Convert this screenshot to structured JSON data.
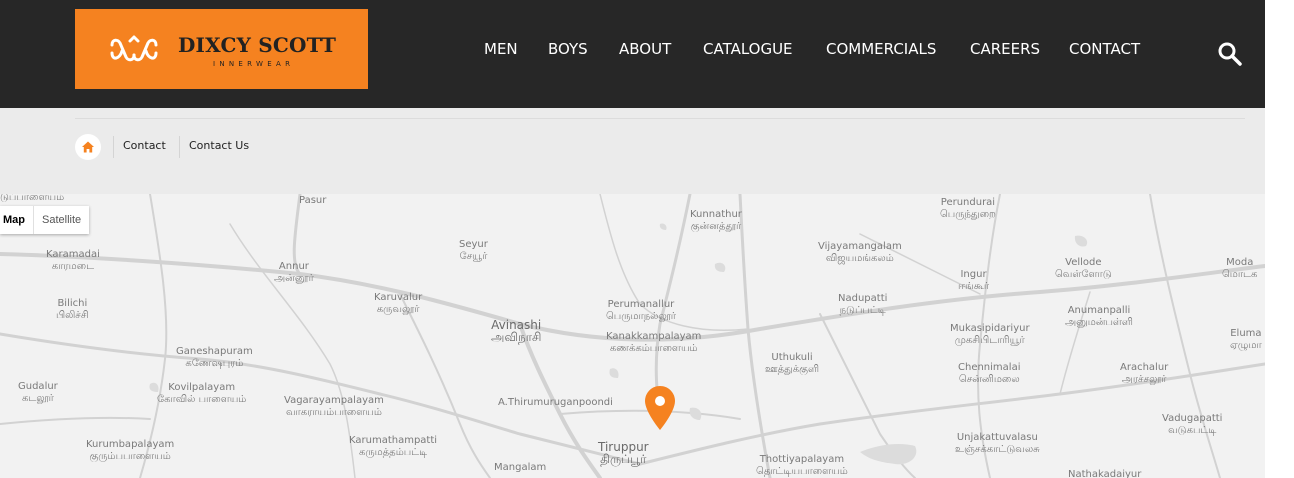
{
  "brand": {
    "title": "DIXCY SCOTT",
    "subtitle": "INNERWEAR",
    "color": "#f58220"
  },
  "nav": {
    "items": [
      "MEN",
      "BOYS",
      "ABOUT",
      "CATALOGUE",
      "COMMERCIALS",
      "CAREERS",
      "CONTACT"
    ],
    "search_icon": "search-icon"
  },
  "breadcrumb": {
    "home_icon": "home-icon",
    "items": [
      "Contact",
      "Contact Us"
    ]
  },
  "map": {
    "toggle": {
      "map": "Map",
      "satellite": "Satellite",
      "selected": "Map"
    },
    "places": [
      {
        "en": "டுப்பாளையம்",
        "ta": ""
      },
      {
        "en": "Pasur",
        "ta": ""
      },
      {
        "en": "Karamadai",
        "ta": "காரமடை"
      },
      {
        "en": "Annur",
        "ta": "அன்னூர்"
      },
      {
        "en": "Seyur",
        "ta": "சேயூர்"
      },
      {
        "en": "Kunnathur",
        "ta": "குன்னத்தூர்"
      },
      {
        "en": "Vijayamangalam",
        "ta": "விஜயமங்கலம்"
      },
      {
        "en": "Perundurai",
        "ta": "பெருந்துறை"
      },
      {
        "en": "Vellode",
        "ta": "வெள்ளோடு"
      },
      {
        "en": "Moda",
        "ta": "மொடக"
      },
      {
        "en": "Ingur",
        "ta": "ஈங்கூர்"
      },
      {
        "en": "Bilichi",
        "ta": "பிலிச்சி"
      },
      {
        "en": "Karuvalur",
        "ta": "கருவலூர்"
      },
      {
        "en": "Perumanallur",
        "ta": "பெருமாநல்லூர்"
      },
      {
        "en": "Nadupatti",
        "ta": "நடுப்பட்டி"
      },
      {
        "en": "Avinashi",
        "ta": "அவிநாசி"
      },
      {
        "en": "Kanakkampalayam",
        "ta": "கணக்கம்பாளையம்"
      },
      {
        "en": "Mukasipidariyur",
        "ta": "முகசிபிடாரியூர்"
      },
      {
        "en": "Anumanpalli",
        "ta": "அனுமன்பள்ளி"
      },
      {
        "en": "Eluma",
        "ta": "ஏழுமா"
      },
      {
        "en": "Ganeshapuram",
        "ta": "கணேஷபுரம்"
      },
      {
        "en": "Uthukuli",
        "ta": "ஊத்துக்குளி"
      },
      {
        "en": "Chennimalai",
        "ta": "சென்னிமலை"
      },
      {
        "en": "Arachalur",
        "ta": "அரச்சலூர்"
      },
      {
        "en": "Gudalur",
        "ta": "கடலூர்"
      },
      {
        "en": "Kovilpalayam",
        "ta": "கோவில் பாளையம்"
      },
      {
        "en": "Vagarayampalayam",
        "ta": "வாகராயம்பாளையம்"
      },
      {
        "en": "A.Thirumuruganpoondi",
        "ta": ""
      },
      {
        "en": "Vadugapatti",
        "ta": "வடுகபட்டி"
      },
      {
        "en": "Kurumbapalayam",
        "ta": "குரும்பபாளையம்"
      },
      {
        "en": "Karumathampatti",
        "ta": "கருமத்தம்பட்டி"
      },
      {
        "en": "Unjakattuvalasu",
        "ta": "உஞ்சக்காட்டுவலசு"
      },
      {
        "en": "Tiruppur",
        "ta": "திருப்பூர்"
      },
      {
        "en": "Thottiyapalayam",
        "ta": "தொட்டியபாளையம்"
      },
      {
        "en": "Mangalam",
        "ta": ""
      },
      {
        "en": "Nathakadaiyur",
        "ta": ""
      }
    ],
    "pin_icon": "map-pin-icon"
  }
}
